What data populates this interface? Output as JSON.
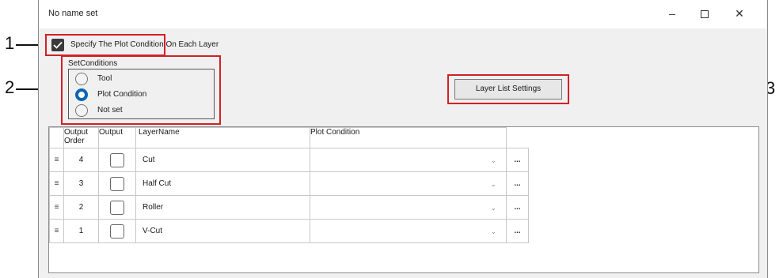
{
  "window": {
    "title": "No name set"
  },
  "callouts": [
    "1",
    "2",
    "3"
  ],
  "specify_checkbox": {
    "label": "Specify The Plot Condition On Each Layer",
    "checked": true
  },
  "set_conditions": {
    "title": "SetConditions",
    "options": [
      {
        "label": "Tool",
        "selected": false
      },
      {
        "label": "Plot Condition",
        "selected": true
      },
      {
        "label": "Not set",
        "selected": false
      }
    ]
  },
  "layer_list_button": {
    "label": "Layer List Settings"
  },
  "grid": {
    "headers": {
      "order": "Output Order",
      "output": "Output",
      "layer_name": "LayerName",
      "plot_condition": "Plot Condition"
    },
    "handle_glyph": "≡",
    "ellipsis_label": "...",
    "rows": [
      {
        "order": "4",
        "name": "Cut",
        "output": false,
        "plot_condition": ""
      },
      {
        "order": "3",
        "name": "Half Cut",
        "output": false,
        "plot_condition": ""
      },
      {
        "order": "2",
        "name": "Roller",
        "output": false,
        "plot_condition": ""
      },
      {
        "order": "1",
        "name": "V-Cut",
        "output": false,
        "plot_condition": ""
      }
    ]
  },
  "colors": {
    "highlight_box": "#d32027",
    "radio_selected": "#0a64b4"
  }
}
